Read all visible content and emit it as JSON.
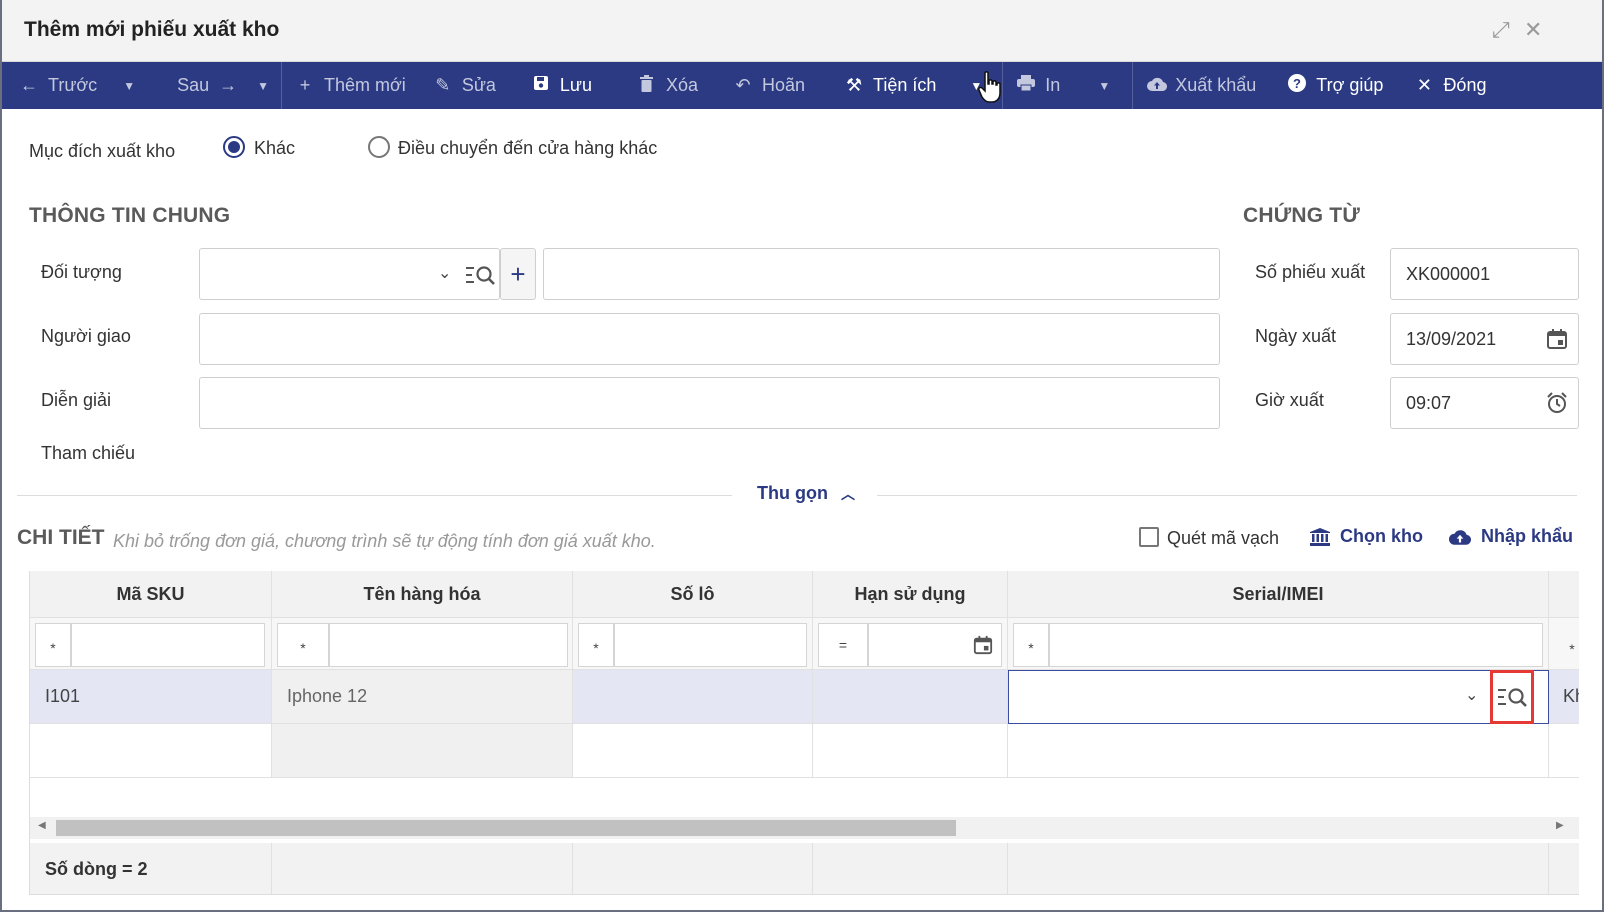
{
  "window": {
    "title": "Thêm mới phiếu xuất kho",
    "expand_glyph": "⤢",
    "close_glyph": "✕"
  },
  "toolbar": {
    "prev": "Trước",
    "next": "Sau",
    "add": "Thêm mới",
    "edit": "Sửa",
    "save": "Lưu",
    "delete": "Xóa",
    "undo": "Hoãn",
    "utilities": "Tiện ích",
    "print": "In",
    "export": "Xuất khẩu",
    "help": "Trợ giúp",
    "close": "Đóng"
  },
  "purpose": {
    "label": "Mục đích xuất kho",
    "options": [
      "Khác",
      "Điều chuyển đến cửa hàng khác"
    ],
    "selected": "Khác"
  },
  "general": {
    "title": "THÔNG TIN CHUNG",
    "doi_tuong_label": "Đối tượng",
    "nguoi_giao_label": "Người giao",
    "dien_giai_label": "Diễn giải",
    "tham_chieu_label": "Tham chiếu"
  },
  "voucher": {
    "title": "CHỨNG TỪ",
    "number_label": "Số phiếu xuất",
    "number_value": "XK000001",
    "date_label": "Ngày xuất",
    "date_value": "13/09/2021",
    "time_label": "Giờ xuất",
    "time_value": "09:07"
  },
  "collapse": {
    "label": "Thu gọn"
  },
  "detail": {
    "title": "CHI TIẾT",
    "hint": "Khi bỏ trống đơn giá, chương trình sẽ tự động tính đơn giá xuất kho.",
    "scan_label": "Quét mã vạch",
    "choose_store": "Chọn kho",
    "import": "Nhập khẩu"
  },
  "grid": {
    "columns": [
      "Mã SKU",
      "Tên hàng hóa",
      "Số lô",
      "Hạn sử dụng",
      "Serial/IMEI"
    ],
    "filter_ops": [
      "*",
      "*",
      "*",
      "=",
      "*",
      "*"
    ],
    "rows": [
      {
        "sku": "I101",
        "name": "Iphone 12",
        "lot": "",
        "expiry": "",
        "serial": "",
        "next_col": "Kh"
      }
    ],
    "footer": "Số dòng = 2"
  },
  "colors": {
    "toolbar_bg": "#2b3a82",
    "accent": "#2b3a82",
    "highlight_border": "#e53935",
    "row_selected": "#e4e7f3"
  }
}
